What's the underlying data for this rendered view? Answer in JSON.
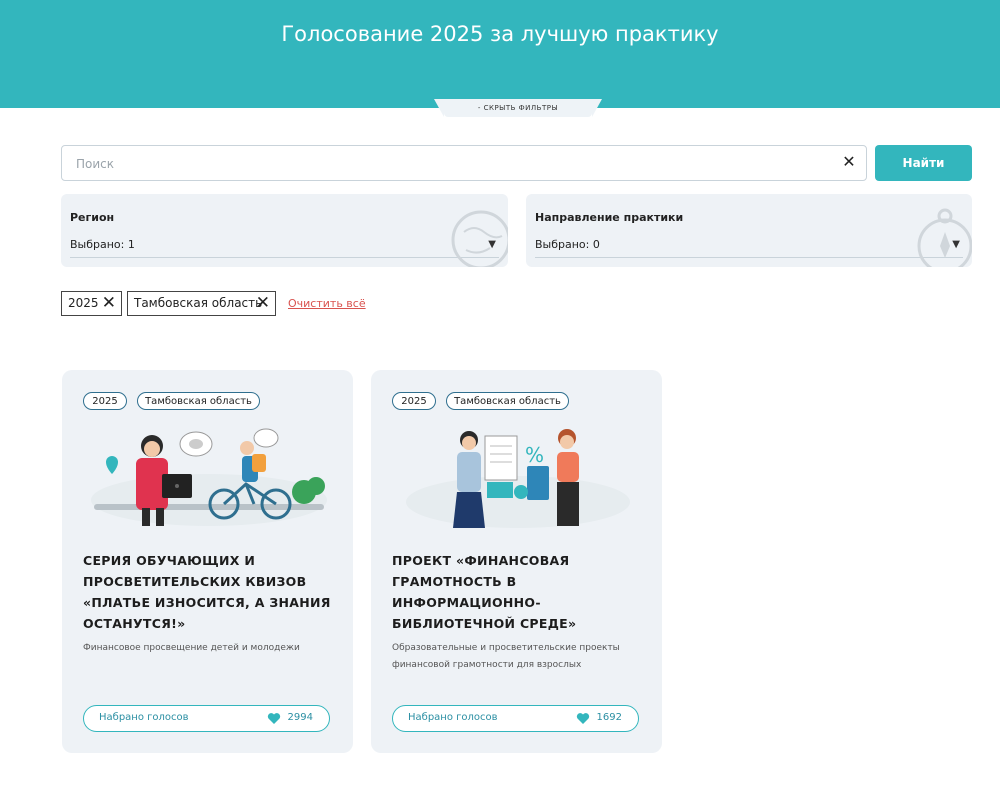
{
  "header": {
    "title": "Голосование 2025 за лучшую практику",
    "toggle_label": "- СКРЫТЬ ФИЛЬТРЫ"
  },
  "search": {
    "placeholder": "Поиск",
    "value": "",
    "clear_icon": "close-icon",
    "button_label": "Найти"
  },
  "filters": [
    {
      "label": "Регион",
      "value": "Выбрано: 1",
      "icon": "globe-icon"
    },
    {
      "label": "Направление практики",
      "value": "Выбрано: 0",
      "icon": "compass-icon"
    }
  ],
  "chips": [
    {
      "label": "2025",
      "remove_icon": "close-icon"
    },
    {
      "label": "Тамбовская область",
      "remove_icon": "close-icon"
    }
  ],
  "clear_all_label": "Очистить всё",
  "cards": [
    {
      "tags": [
        "2025",
        "Тамбовская область"
      ],
      "title": "СЕРИЯ ОБУЧАЮЩИХ И ПРОСВЕТИТЕЛЬСКИХ КВИЗОВ «ПЛАТЬЕ ИЗНОСИТСЯ, А ЗНАНИЯ ОСТАНУТСЯ!»",
      "description": "Финансовое просвещение детей и молодежи",
      "votes_label": "Набрано голосов",
      "votes_count": "2994",
      "illustration": "woman-laptop-cyclist-illustration"
    },
    {
      "tags": [
        "2025",
        "Тамбовская область"
      ],
      "title": "ПРОЕКТ «ФИНАНСОВАЯ ГРАМОТНОСТЬ В ИНФОРМАЦИОННО-БИБЛИОТЕЧНОЙ СРЕДЕ»",
      "description": "Образовательные и просветительские проекты финансовой грамотности для взрослых",
      "votes_label": "Набрано голосов",
      "votes_count": "1692",
      "illustration": "finance-consultation-illustration"
    }
  ],
  "colors": {
    "accent": "#33b6bd",
    "card_bg": "#eef2f6",
    "danger": "#d9534f"
  }
}
